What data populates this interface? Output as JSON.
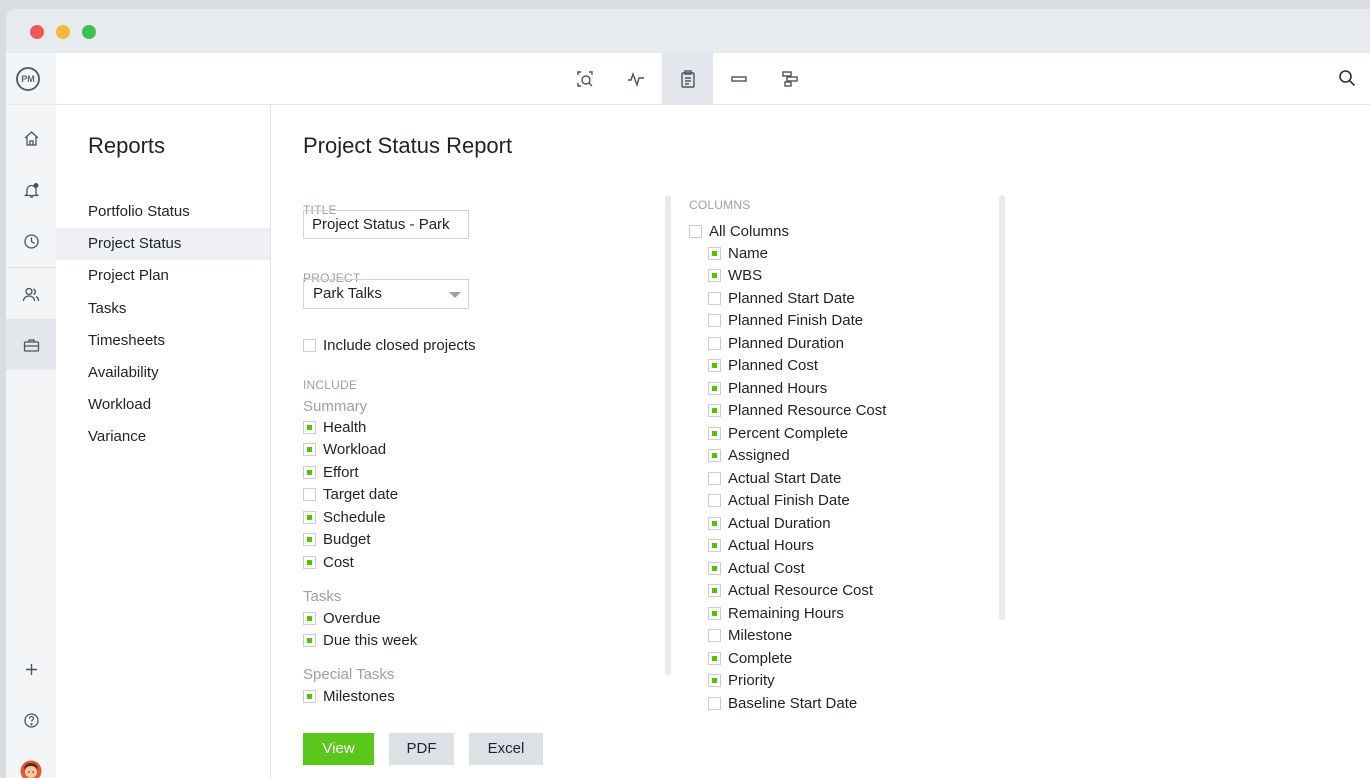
{
  "toolbar": {
    "logo_text": "PM",
    "views": [
      {
        "icon": "search-doc-icon"
      },
      {
        "icon": "activity-icon"
      },
      {
        "icon": "clipboard-icon"
      },
      {
        "icon": "minus-bar-icon"
      },
      {
        "icon": "gantt-icon"
      }
    ],
    "active_view": 2
  },
  "rail": {
    "icons": [
      "home-icon",
      "bell-icon",
      "clock-icon",
      "users-icon",
      "briefcase-icon",
      "plus-icon",
      "help-icon",
      "avatar"
    ]
  },
  "sidebar": {
    "title": "Reports",
    "items": [
      {
        "label": "Portfolio Status"
      },
      {
        "label": "Project Status"
      },
      {
        "label": "Project Plan"
      },
      {
        "label": "Tasks"
      },
      {
        "label": "Timesheets"
      },
      {
        "label": "Availability"
      },
      {
        "label": "Workload"
      },
      {
        "label": "Variance"
      }
    ],
    "active_index": 1
  },
  "main": {
    "title": "Project Status Report",
    "title_label": "TITLE",
    "title_value": "Project Status - Park",
    "project_label": "PROJECT",
    "project_value": "Park Talks",
    "include_closed": {
      "label": "Include closed projects",
      "checked": false
    },
    "include_label": "INCLUDE",
    "summary_label": "Summary",
    "summary": [
      {
        "label": "Health",
        "checked": true
      },
      {
        "label": "Workload",
        "checked": true
      },
      {
        "label": "Effort",
        "checked": true
      },
      {
        "label": "Target date",
        "checked": false
      },
      {
        "label": "Schedule",
        "checked": true
      },
      {
        "label": "Budget",
        "checked": true
      },
      {
        "label": "Cost",
        "checked": true
      }
    ],
    "tasks_label": "Tasks",
    "tasks": [
      {
        "label": "Overdue",
        "checked": true
      },
      {
        "label": "Due this week",
        "checked": true
      }
    ],
    "special_label": "Special Tasks",
    "special": [
      {
        "label": "Milestones",
        "checked": true
      }
    ],
    "columns_label": "COLUMNS",
    "all_columns": {
      "label": "All Columns",
      "checked": false
    },
    "columns": [
      {
        "label": "Name",
        "checked": true
      },
      {
        "label": "WBS",
        "checked": true
      },
      {
        "label": "Planned Start Date",
        "checked": false
      },
      {
        "label": "Planned Finish Date",
        "checked": false
      },
      {
        "label": "Planned Duration",
        "checked": false
      },
      {
        "label": "Planned Cost",
        "checked": true
      },
      {
        "label": "Planned Hours",
        "checked": true
      },
      {
        "label": "Planned Resource Cost",
        "checked": true
      },
      {
        "label": "Percent Complete",
        "checked": true
      },
      {
        "label": "Assigned",
        "checked": true
      },
      {
        "label": "Actual Start Date",
        "checked": false
      },
      {
        "label": "Actual Finish Date",
        "checked": false
      },
      {
        "label": "Actual Duration",
        "checked": true
      },
      {
        "label": "Actual Hours",
        "checked": true
      },
      {
        "label": "Actual Cost",
        "checked": true
      },
      {
        "label": "Actual Resource Cost",
        "checked": true
      },
      {
        "label": "Remaining Hours",
        "checked": true
      },
      {
        "label": "Milestone",
        "checked": false
      },
      {
        "label": "Complete",
        "checked": true
      },
      {
        "label": "Priority",
        "checked": true
      },
      {
        "label": "Baseline Start Date",
        "checked": false
      }
    ],
    "buttons": {
      "view": "View",
      "pdf": "PDF",
      "excel": "Excel"
    }
  },
  "colors": {
    "accent": "#5ac81a",
    "check": "#55c400"
  }
}
